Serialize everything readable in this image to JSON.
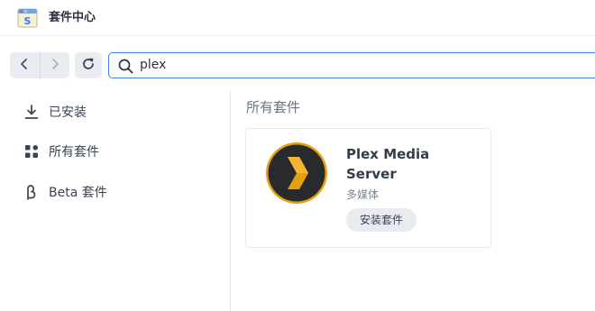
{
  "window": {
    "title": "套件中心",
    "app_icon": "package-center-icon"
  },
  "toolbar": {
    "back_icon": "chevron-left-icon",
    "forward_icon": "chevron-right-icon",
    "refresh_icon": "refresh-icon",
    "search": {
      "icon": "search-icon",
      "value": "plex",
      "placeholder": ""
    }
  },
  "sidebar": {
    "items": [
      {
        "label": "已安装",
        "icon": "download-icon"
      },
      {
        "label": "所有套件",
        "icon": "grid-icon"
      },
      {
        "label": "Beta 套件",
        "icon": "beta-icon"
      }
    ]
  },
  "main": {
    "section_title": "所有套件",
    "packages": [
      {
        "name": "Plex Media Server",
        "category": "多媒体",
        "action_label": "安装套件",
        "icon": "plex-logo-icon"
      }
    ]
  },
  "colors": {
    "accent": "#3a7ee6",
    "plex_gold": "#e5a00d",
    "plex_bg": "#282a2d"
  }
}
